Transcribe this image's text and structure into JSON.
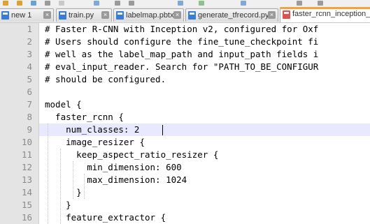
{
  "tabs": [
    {
      "label": "new 1",
      "active": false
    },
    {
      "label": "train.py",
      "active": false
    },
    {
      "label": "labelmap.pbtxt",
      "active": false
    },
    {
      "label": "generate_tfrecord.py",
      "active": false
    },
    {
      "label": "faster_rcnn_inception_v",
      "active": true
    }
  ],
  "close_glyph": "×",
  "colors": {
    "active_tab_accent": "#f6a23c",
    "current_line": "#e8e8ff",
    "gutter": "#e4e4e4"
  },
  "editor": {
    "line_numbers": [
      "1",
      "2",
      "3",
      "4",
      "5",
      "6",
      "7",
      "8",
      "9",
      "10",
      "11",
      "12",
      "13",
      "14",
      "15",
      "16"
    ],
    "lines": [
      "# Faster R-CNN with Inception v2, configured for Oxf",
      "# Users should configure the fine_tune_checkpoint fi",
      "# well as the label_map_path and input_path fields i",
      "# eval_input_reader. Search for \"PATH_TO_BE_CONFIGUR",
      "# should be configured.",
      "",
      "model {",
      "  faster_rcnn {",
      "    num_classes: 2",
      "    image_resizer {",
      "      keep_aspect_ratio_resizer {",
      "        min_dimension: 600",
      "        max_dimension: 1024",
      "      }",
      "    }",
      "    feature_extractor {"
    ],
    "current_line": 9
  }
}
